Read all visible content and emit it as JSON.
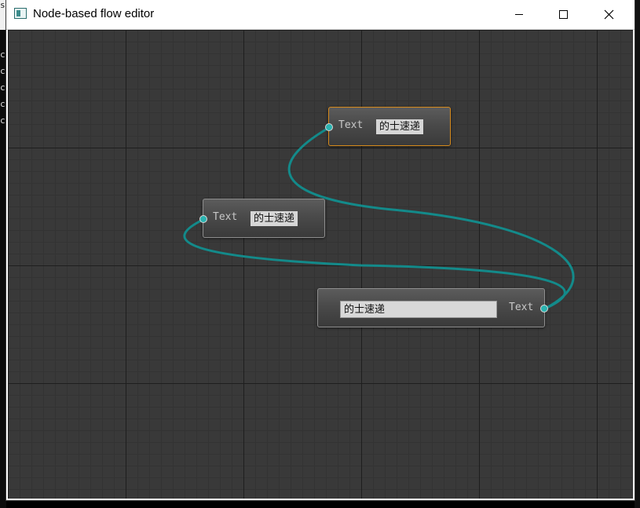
{
  "window": {
    "title": "Node-based flow editor",
    "minimize_icon": "minimize-icon",
    "maximize_icon": "maximize-icon",
    "close_icon": "close-icon"
  },
  "colors": {
    "connection": "#138a8a",
    "port": "#2bb3b0",
    "selected_border": "#d68a1c",
    "canvas_bg": "#393939"
  },
  "nodes": [
    {
      "id": "node-top",
      "selected": true,
      "port_label": "Text",
      "value": "的士速递"
    },
    {
      "id": "node-middle",
      "selected": false,
      "port_label": "Text",
      "value": "的士速递"
    },
    {
      "id": "node-bottom",
      "selected": false,
      "input_value": "的士速递",
      "port_label": "Text"
    }
  ],
  "background_console": {
    "top_glyph": "s",
    "edge_glyphs": [
      "c",
      "c",
      "c",
      "c",
      "c"
    ]
  }
}
